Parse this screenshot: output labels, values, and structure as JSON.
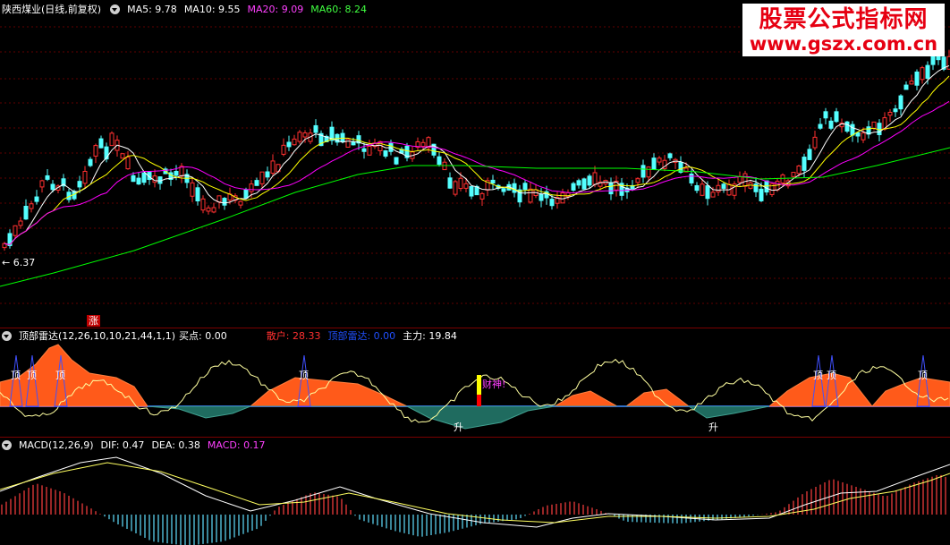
{
  "main": {
    "stock": "陕西煤业(日线,前复权)",
    "ma5": "MA5: 9.78",
    "ma10": "MA10: 9.55",
    "ma20": "MA20: 9.09",
    "ma60": "MA60: 8.24",
    "low_label": "6.37",
    "marker_zhang": "涨"
  },
  "watermark": {
    "cn": "股票公式指标网",
    "url": "www.gszx.com.cn"
  },
  "radar": {
    "title": "顶部雷达(12,26,10,10,21,44,1,1)",
    "buy": "买点: 0.00",
    "retail": "散户: 28.33",
    "top": "顶部雷达: 0.00",
    "main": "主力: 19.84",
    "ding": "顶",
    "sheng": "升",
    "caishen": "财神!"
  },
  "macd": {
    "title": "MACD(12,26,9)",
    "dif": "DIF: 0.47",
    "dea": "DEA: 0.38",
    "macd": "MACD: 0.17"
  },
  "colors": {
    "up": "#ff3030",
    "down": "#54ffff",
    "ma5": "#ffffff",
    "ma10": "#ffff00",
    "ma20": "#ff00ff",
    "ma60": "#00ff00",
    "retail_fill": "#ff5a1a",
    "main_fill": "#1f6b5f"
  }
}
